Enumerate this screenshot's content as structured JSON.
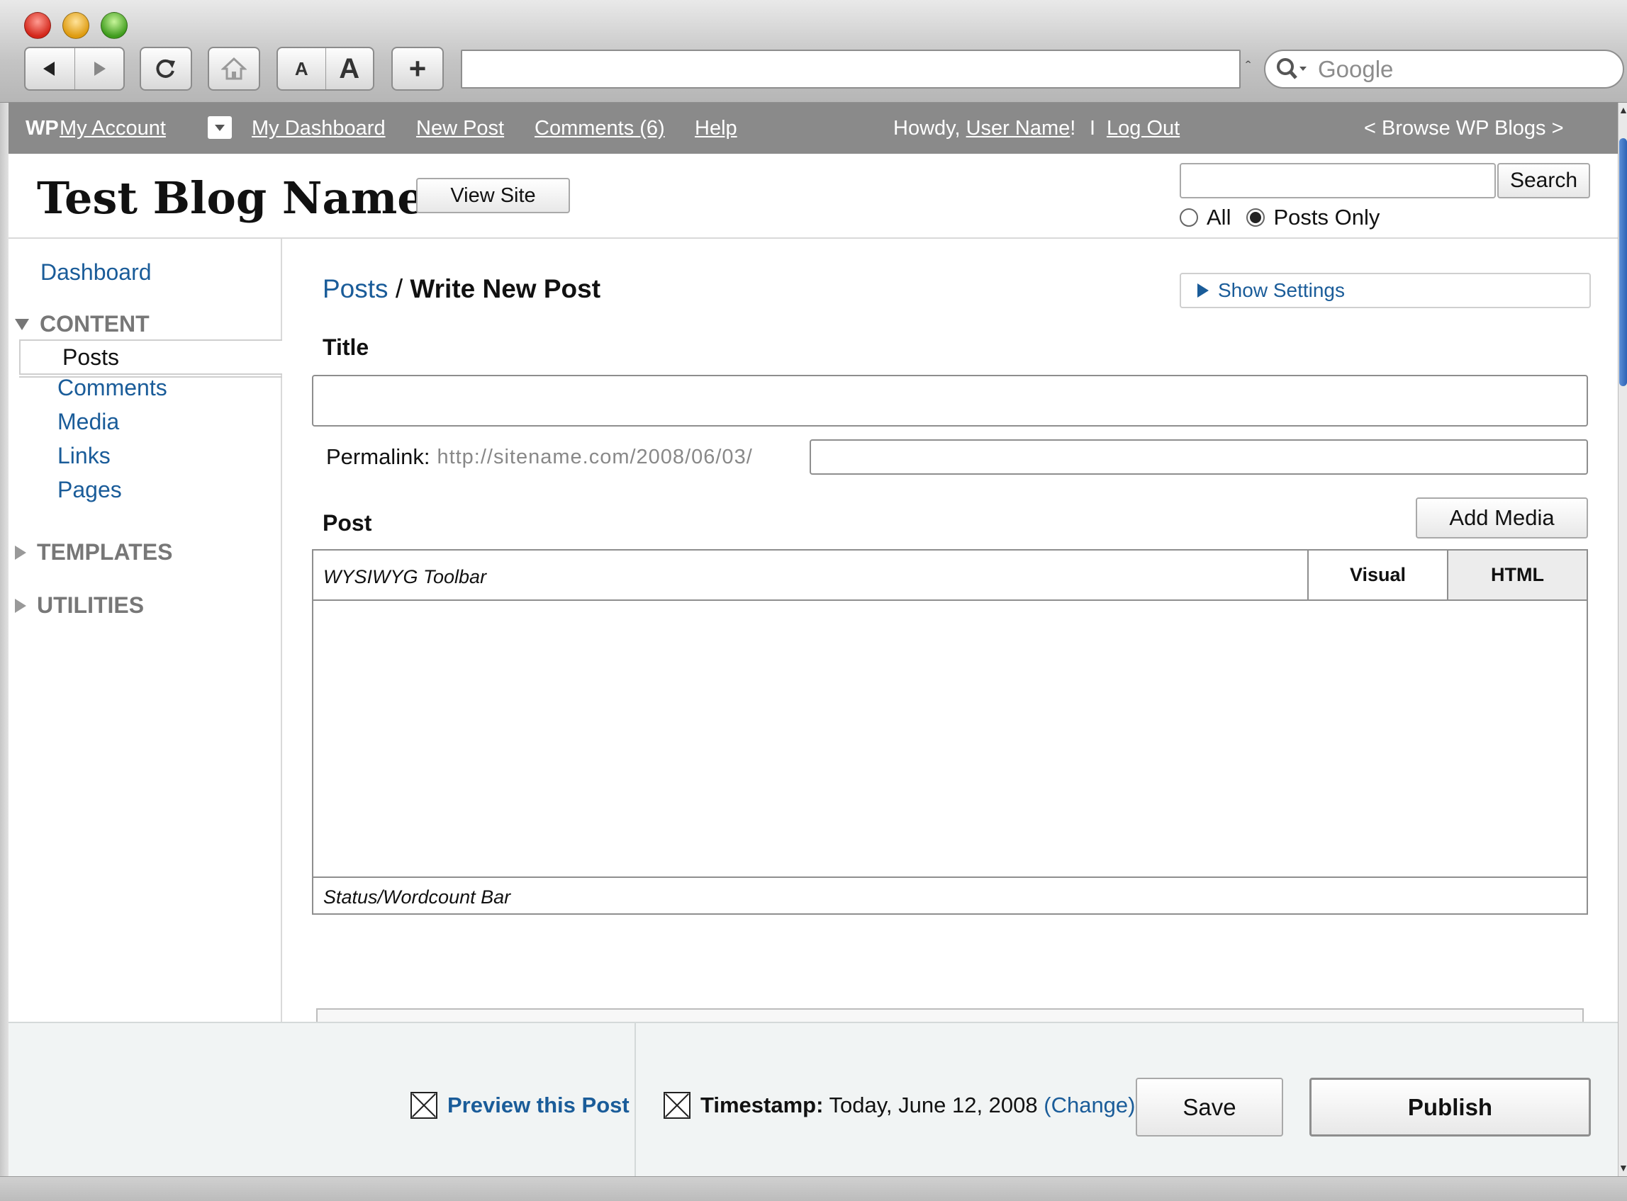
{
  "browser": {
    "toolbar": {
      "text_small": "A",
      "text_large": "A",
      "add": "+"
    },
    "address_bar": {
      "value": ""
    },
    "search_placeholder": "Google"
  },
  "adminbar": {
    "logo": "WP",
    "my_account": "My Account",
    "my_dashboard": "My Dashboard",
    "new_post": "New Post",
    "comments": "Comments (6)",
    "help": "Help",
    "howdy": "Howdy, ",
    "user_name": "User Name",
    "howdy_end": "!",
    "sep": "I",
    "log_out": "Log Out",
    "browse": "< Browse WP Blogs >"
  },
  "header": {
    "blog_name": "Test Blog Name",
    "view_site": "View Site",
    "search_button": "Search",
    "search_value": "",
    "radio_all": "All",
    "radio_posts_only": "Posts Only",
    "selected_scope": "Posts Only"
  },
  "sidebar": {
    "dashboard": "Dashboard",
    "content_section": "CONTENT",
    "items": [
      {
        "label": "Posts",
        "current": true
      },
      {
        "label": "Comments"
      },
      {
        "label": "Media"
      },
      {
        "label": "Links"
      },
      {
        "label": "Pages"
      }
    ],
    "templates_section": "TEMPLATES",
    "utilities_section": "UTILITIES"
  },
  "main": {
    "breadcrumb_parent": "Posts",
    "breadcrumb_sep": " / ",
    "breadcrumb_current": "Write New Post",
    "show_settings": "Show Settings",
    "title_label": "Title",
    "title_value": "",
    "permalink_label": "Permalink:",
    "permalink_base": "http://sitename.com/2008/06/03/",
    "permalink_slug": "",
    "post_label": "Post",
    "add_media": "Add Media",
    "editor": {
      "toolbar": "WYSIWYG Toolbar",
      "tab_visual": "Visual",
      "tab_html": "HTML",
      "status_bar": "Status/Wordcount Bar"
    }
  },
  "actions": {
    "preview": "Preview this Post",
    "timestamp_label": "Timestamp:",
    "timestamp_value": " Today, June 12, 2008 ",
    "timestamp_change": "(Change)",
    "save": "Save",
    "publish": "Publish"
  },
  "colors": {
    "link": "#1a5c99",
    "admin_bar": "#8a8a8a",
    "action_bar": "#f1f4f4"
  }
}
